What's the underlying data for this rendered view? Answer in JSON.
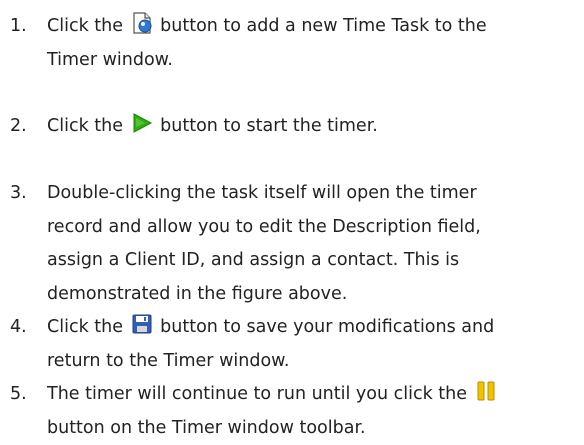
{
  "steps": [
    {
      "number": "1.",
      "line1_before": "Click the",
      "icon": "new-task-icon",
      "line1_after": "button to add a new Time Task to the",
      "line2": "Timer window."
    },
    {
      "number": "2.",
      "line1_before": "Click the",
      "icon": "play-icon",
      "line1_after": "button to start the timer."
    },
    {
      "number": "3.",
      "line1": "Double-clicking the task itself will open the timer",
      "line2": "record and allow you to edit the Description field,",
      "line3": "assign a Client ID, and assign a contact. This is",
      "line4": "demonstrated in the figure above."
    },
    {
      "number": "4.",
      "line1_before": "Click the",
      "icon": "save-icon",
      "line1_after": "button to save your modifications and",
      "line2": "return to the Timer window."
    },
    {
      "number": "5.",
      "line1_before": "The timer will continue to run until you click the",
      "icon": "pause-icon",
      "line2": "button on the Timer window toolbar."
    }
  ],
  "colors": {
    "text": "#222222",
    "play_green": "#2fae12",
    "save_blue": "#2f5fb8",
    "pause_yellow": "#f2c200"
  }
}
